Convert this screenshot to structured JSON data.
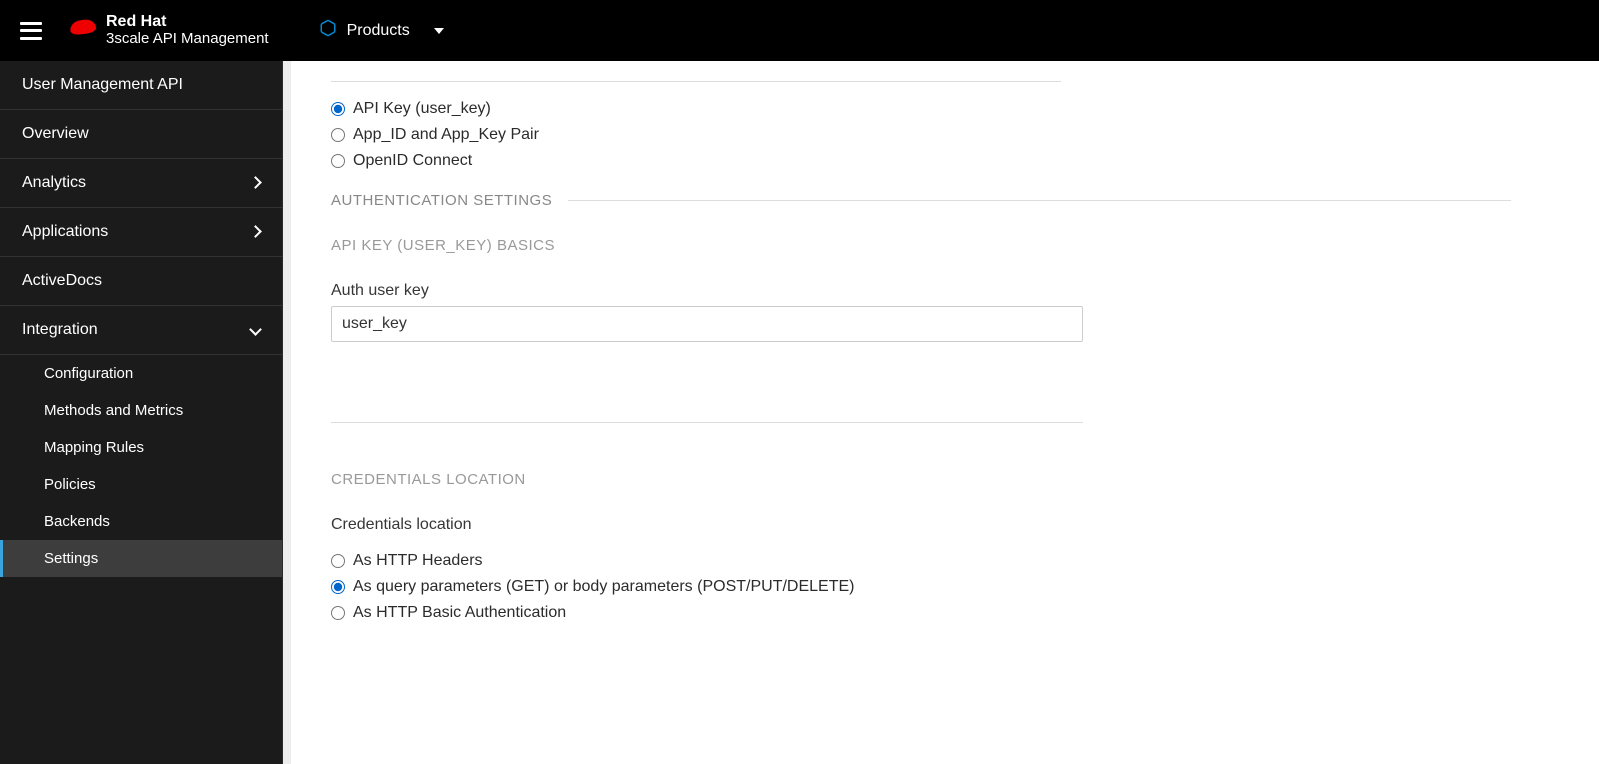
{
  "header": {
    "brand_top": "Red Hat",
    "brand_bottom": "3scale API Management",
    "nav_label": "Products"
  },
  "sidebar": {
    "title": "User Management API",
    "items": [
      {
        "label": "Overview"
      },
      {
        "label": "Analytics",
        "expandable": true
      },
      {
        "label": "Applications",
        "expandable": true
      },
      {
        "label": "ActiveDocs"
      },
      {
        "label": "Integration",
        "expanded": true
      }
    ],
    "integration_children": [
      {
        "label": "Configuration"
      },
      {
        "label": "Methods and Metrics"
      },
      {
        "label": "Mapping Rules"
      },
      {
        "label": "Policies"
      },
      {
        "label": "Backends"
      },
      {
        "label": "Settings",
        "active": true
      }
    ]
  },
  "main": {
    "auth_method": {
      "options": [
        {
          "label": "API Key (user_key)",
          "checked": true
        },
        {
          "label": "App_ID and App_Key Pair",
          "checked": false
        },
        {
          "label": "OpenID Connect",
          "checked": false
        }
      ]
    },
    "auth_settings_heading": "AUTHENTICATION SETTINGS",
    "api_key_basics_heading": "API KEY (USER_KEY) BASICS",
    "auth_user_key_label": "Auth user key",
    "auth_user_key_value": "user_key",
    "credentials_location_heading": "CREDENTIALS LOCATION",
    "credentials_location_label": "Credentials location",
    "credentials_options": [
      {
        "label": "As HTTP Headers",
        "checked": false
      },
      {
        "label": "As query parameters (GET) or body parameters (POST/PUT/DELETE)",
        "checked": true
      },
      {
        "label": "As HTTP Basic Authentication",
        "checked": false
      }
    ]
  }
}
